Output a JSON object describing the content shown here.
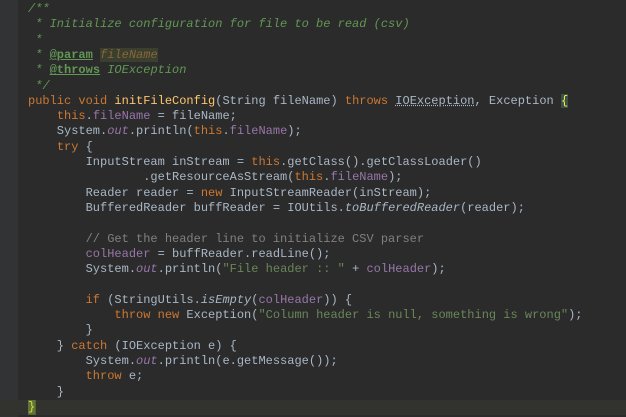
{
  "lines": [
    [
      {
        "t": "/**",
        "c": "t-doc"
      }
    ],
    [
      {
        "t": " * Initialize configuration for file to be read (csv)",
        "c": "t-doc"
      }
    ],
    [
      {
        "t": " *",
        "c": "t-doc"
      }
    ],
    [
      {
        "t": " * ",
        "c": "t-doc"
      },
      {
        "t": "@param",
        "c": "t-doctag"
      },
      {
        "t": " ",
        "c": "t-doc"
      },
      {
        "t": "fileName",
        "c": "t-docparam"
      }
    ],
    [
      {
        "t": " * ",
        "c": "t-doc"
      },
      {
        "t": "@throws",
        "c": "t-doctag"
      },
      {
        "t": " IOException",
        "c": "t-doc"
      }
    ],
    [
      {
        "t": " */",
        "c": "t-doc"
      }
    ],
    [
      {
        "t": "public void ",
        "c": "t-kw"
      },
      {
        "t": "initFileConfig",
        "c": "t-method"
      },
      {
        "t": "(String fileName) "
      },
      {
        "t": "throws ",
        "c": "t-kw"
      },
      {
        "t": "IOException",
        "c": "t-warn"
      },
      {
        "t": ", Exception "
      },
      {
        "t": "{",
        "c": "t-brace"
      }
    ],
    [
      {
        "t": "    "
      },
      {
        "t": "this",
        "c": "t-kw"
      },
      {
        "t": "."
      },
      {
        "t": "fileName",
        "c": "t-field"
      },
      {
        "t": " = fileName;"
      }
    ],
    [
      {
        "t": "    System."
      },
      {
        "t": "out",
        "c": "t-static"
      },
      {
        "t": ".println("
      },
      {
        "t": "this",
        "c": "t-kw"
      },
      {
        "t": "."
      },
      {
        "t": "fileName",
        "c": "t-field"
      },
      {
        "t": ");"
      }
    ],
    [
      {
        "t": "    "
      },
      {
        "t": "try",
        "c": "t-kw"
      },
      {
        "t": " {"
      }
    ],
    [
      {
        "t": "        InputStream inStream = "
      },
      {
        "t": "this",
        "c": "t-kw"
      },
      {
        "t": ".getClass().getClassLoader()"
      }
    ],
    [
      {
        "t": "                .getResourceAsStream("
      },
      {
        "t": "this",
        "c": "t-kw"
      },
      {
        "t": "."
      },
      {
        "t": "fileName",
        "c": "t-field"
      },
      {
        "t": ");"
      }
    ],
    [
      {
        "t": "        Reader reader = "
      },
      {
        "t": "new",
        "c": "t-kw"
      },
      {
        "t": " InputStreamReader(inStream);"
      }
    ],
    [
      {
        "t": "        BufferedReader buffReader = IOUtils."
      },
      {
        "t": "toBufferedReader",
        "c": "t-italic"
      },
      {
        "t": "(reader);"
      }
    ],
    [
      {
        "t": ""
      }
    ],
    [
      {
        "t": "        "
      },
      {
        "t": "// Get the header line to initialize CSV parser",
        "c": "t-cmt"
      }
    ],
    [
      {
        "t": "        "
      },
      {
        "t": "colHeader",
        "c": "t-field"
      },
      {
        "t": " = buffReader.readLine();"
      }
    ],
    [
      {
        "t": "        System."
      },
      {
        "t": "out",
        "c": "t-static"
      },
      {
        "t": ".println("
      },
      {
        "t": "\"File header :: \"",
        "c": "t-str"
      },
      {
        "t": " + "
      },
      {
        "t": "colHeader",
        "c": "t-field"
      },
      {
        "t": ");"
      }
    ],
    [
      {
        "t": ""
      }
    ],
    [
      {
        "t": "        "
      },
      {
        "t": "if",
        "c": "t-kw"
      },
      {
        "t": " (StringUtils."
      },
      {
        "t": "isEmpty",
        "c": "t-italic"
      },
      {
        "t": "("
      },
      {
        "t": "colHeader",
        "c": "t-field"
      },
      {
        "t": ")) {"
      }
    ],
    [
      {
        "t": "            "
      },
      {
        "t": "throw new",
        "c": "t-kw"
      },
      {
        "t": " Exception("
      },
      {
        "t": "\"Column header is null, something is wrong\"",
        "c": "t-str"
      },
      {
        "t": ");"
      }
    ],
    [
      {
        "t": "        }"
      }
    ],
    [
      {
        "t": "    } "
      },
      {
        "t": "catch",
        "c": "t-kw"
      },
      {
        "t": " (IOException e) {"
      }
    ],
    [
      {
        "t": "        System."
      },
      {
        "t": "out",
        "c": "t-static"
      },
      {
        "t": ".println(e.getMessage());"
      }
    ],
    [
      {
        "t": "        "
      },
      {
        "t": "throw",
        "c": "t-kw"
      },
      {
        "t": " e;"
      }
    ],
    [
      {
        "t": "    }"
      }
    ],
    [
      {
        "t": "}",
        "c": "t-brace"
      }
    ]
  ]
}
